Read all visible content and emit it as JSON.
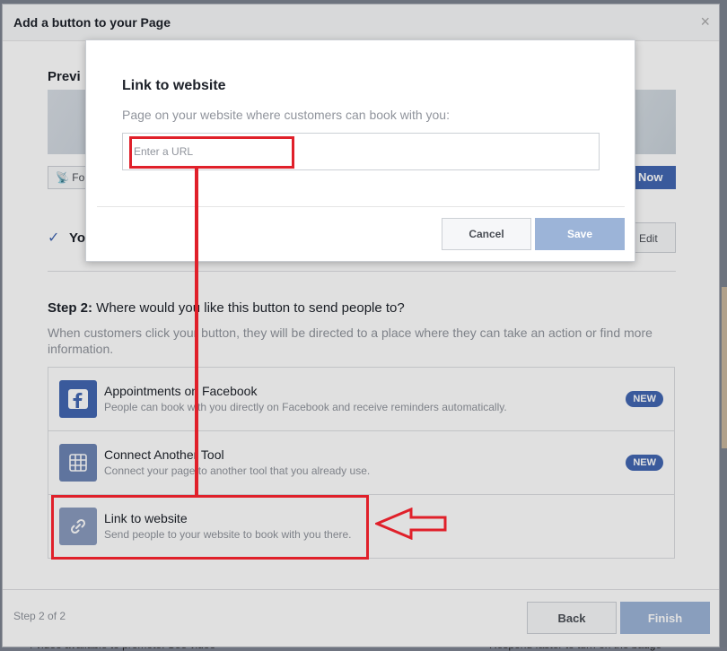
{
  "dialog": {
    "title": "Add a button to your Page",
    "close_glyph": "×",
    "preview_label": "Previ",
    "follow_label": "Fo",
    "book_label": "Now",
    "step1_check": "✓",
    "step1_text": "Yo",
    "edit_label": "Edit",
    "step2_prefix": "Step 2:",
    "step2_question": " Where would you like this button to send people to?",
    "step2_desc": "When customers click your button, they will be directed to a place where they can take an action or find more information.",
    "options": [
      {
        "title": "Appointments on Facebook",
        "desc": "People can book with you directly on Facebook and receive reminders automatically.",
        "badge": "NEW",
        "icon": "facebook-icon"
      },
      {
        "title": "Connect Another Tool",
        "desc": "Connect your page to another tool that you already use.",
        "badge": "NEW",
        "icon": "grid-tool-icon"
      },
      {
        "title": "Link to website",
        "desc": "Send people to your website to book with you there.",
        "badge": "",
        "icon": "link-icon"
      }
    ],
    "step_count": "Step 2 of 2",
    "back_label": "Back",
    "finish_label": "Finish"
  },
  "modal": {
    "title": "Link to website",
    "subtitle": "Page on your website where customers can book with you:",
    "url_placeholder": "Enter a URL",
    "url_value": "",
    "cancel_label": "Cancel",
    "save_label": "Save"
  },
  "background": {
    "bottom_left_text": "4 video available to promote. See video",
    "bottom_right_text": "Respond faster to turn on the badge"
  },
  "colors": {
    "accent": "#4267b2",
    "disabled_button": "#9cb4d8",
    "annotation": "#e0202a"
  }
}
